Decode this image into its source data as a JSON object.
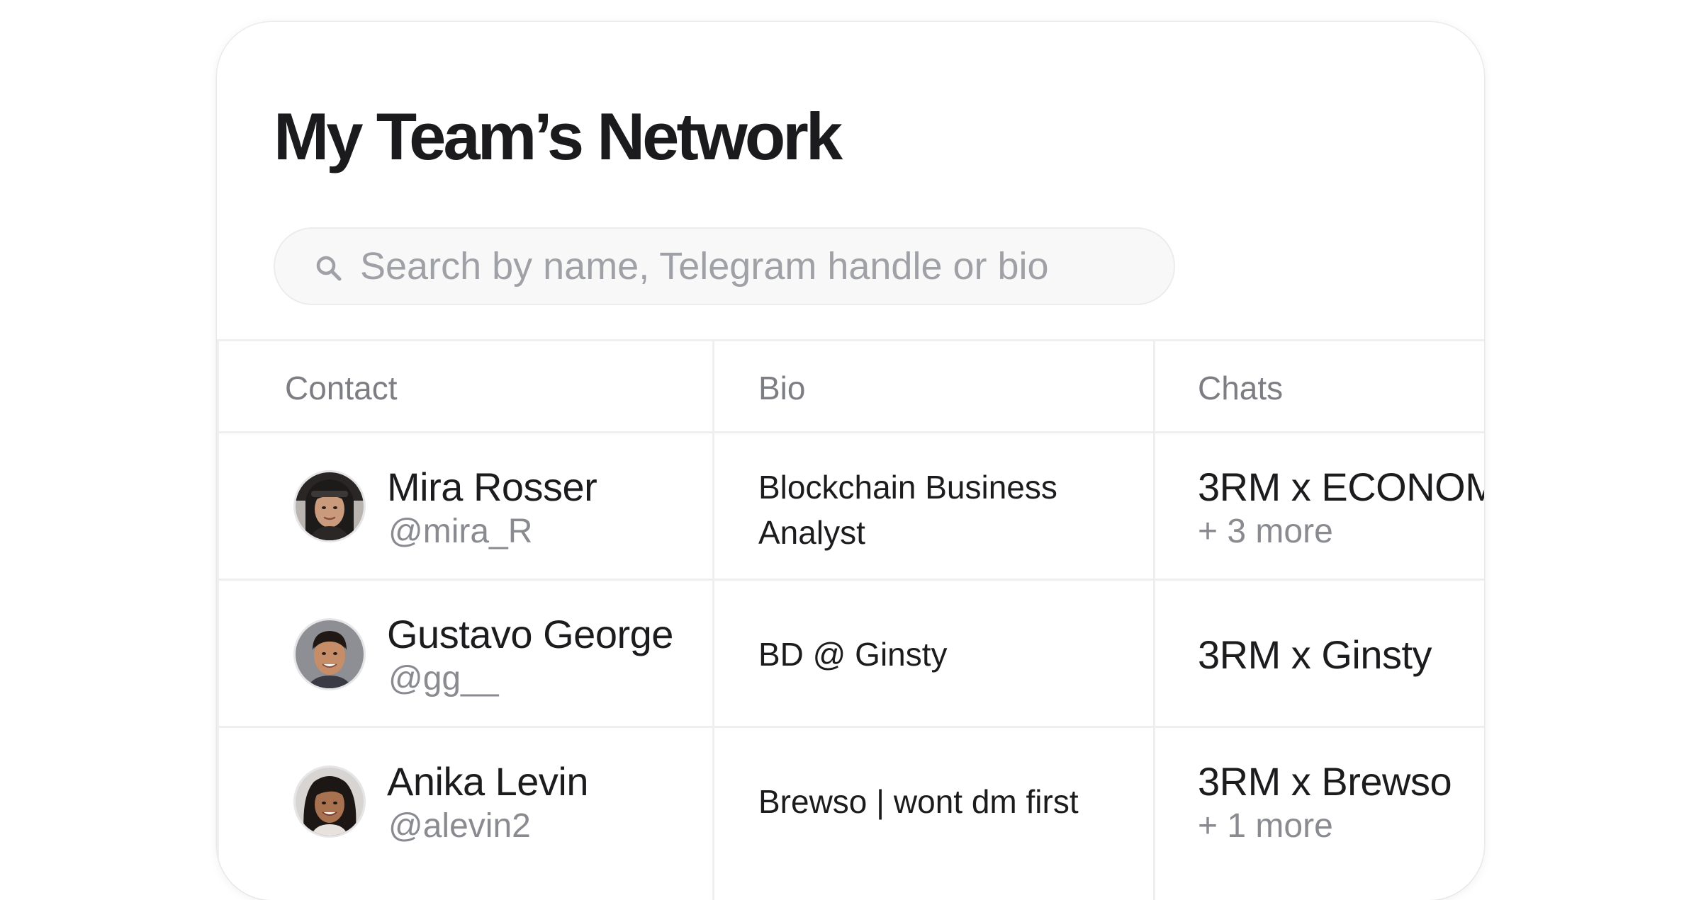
{
  "page": {
    "title": "My Team’s Network"
  },
  "search": {
    "placeholder": "Search by name, Telegram handle or bio",
    "value": ""
  },
  "table": {
    "headers": {
      "contact": "Contact",
      "bio": "Bio",
      "chats": "Chats"
    },
    "rows": [
      {
        "name": "Mira Rosser",
        "handle": "@mira_R",
        "bio": "Blockchain Business Analyst",
        "chat": "3RM x ECONOM",
        "more": "+ 3 more"
      },
      {
        "name": "Gustavo George",
        "handle": "@gg__",
        "bio": "BD @ Ginsty",
        "chat": "3RM x Ginsty",
        "more": ""
      },
      {
        "name": "Anika Levin",
        "handle": "@alevin2",
        "bio": "Brewso | wont dm first",
        "chat": "3RM x Brewso",
        "more": "+ 1 more"
      }
    ]
  },
  "icons": {
    "search": "search-icon"
  },
  "colors": {
    "title": "#1b1b1d",
    "muted_text": "#8a8b90",
    "header_text": "#7d7e83",
    "border": "#efeff1",
    "search_bg": "#f8f8f9"
  }
}
